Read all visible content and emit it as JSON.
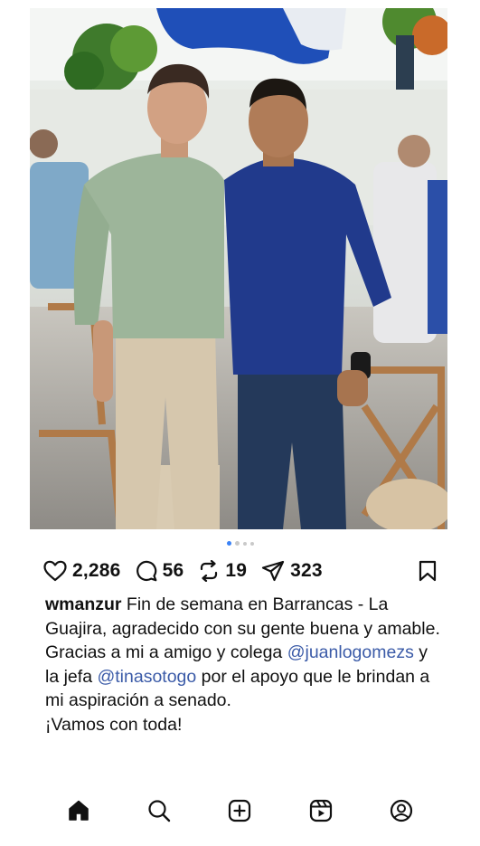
{
  "post": {
    "image_alt": "Two men posing together at an outdoor restaurant",
    "carousel": {
      "total": 4,
      "active_index": 0
    },
    "actions": {
      "likes": "2,286",
      "comments": "56",
      "reposts": "19",
      "shares": "323"
    },
    "caption": {
      "username": "wmanzur",
      "line1": " Fin de semana en Barrancas - La Guajira, agradecido con su gente buena y amable.",
      "line2_pre": "Gracias a mi a amigo y colega ",
      "mention1": "@juanlogomezs",
      "line2_mid": " y la jefa ",
      "mention2": "@tinasotogo",
      "line2_post": " por el apoyo que le brindan a mi aspiración a senado.",
      "line3": "¡Vamos con toda!"
    }
  },
  "tabbar": {
    "icons": [
      "home-icon",
      "search-icon",
      "create-icon",
      "reels-icon",
      "profile-icon"
    ],
    "active": "home-icon"
  },
  "colors": {
    "mention": "#3b5ba8",
    "carousel_active": "#3b82f6",
    "text": "#111111"
  }
}
